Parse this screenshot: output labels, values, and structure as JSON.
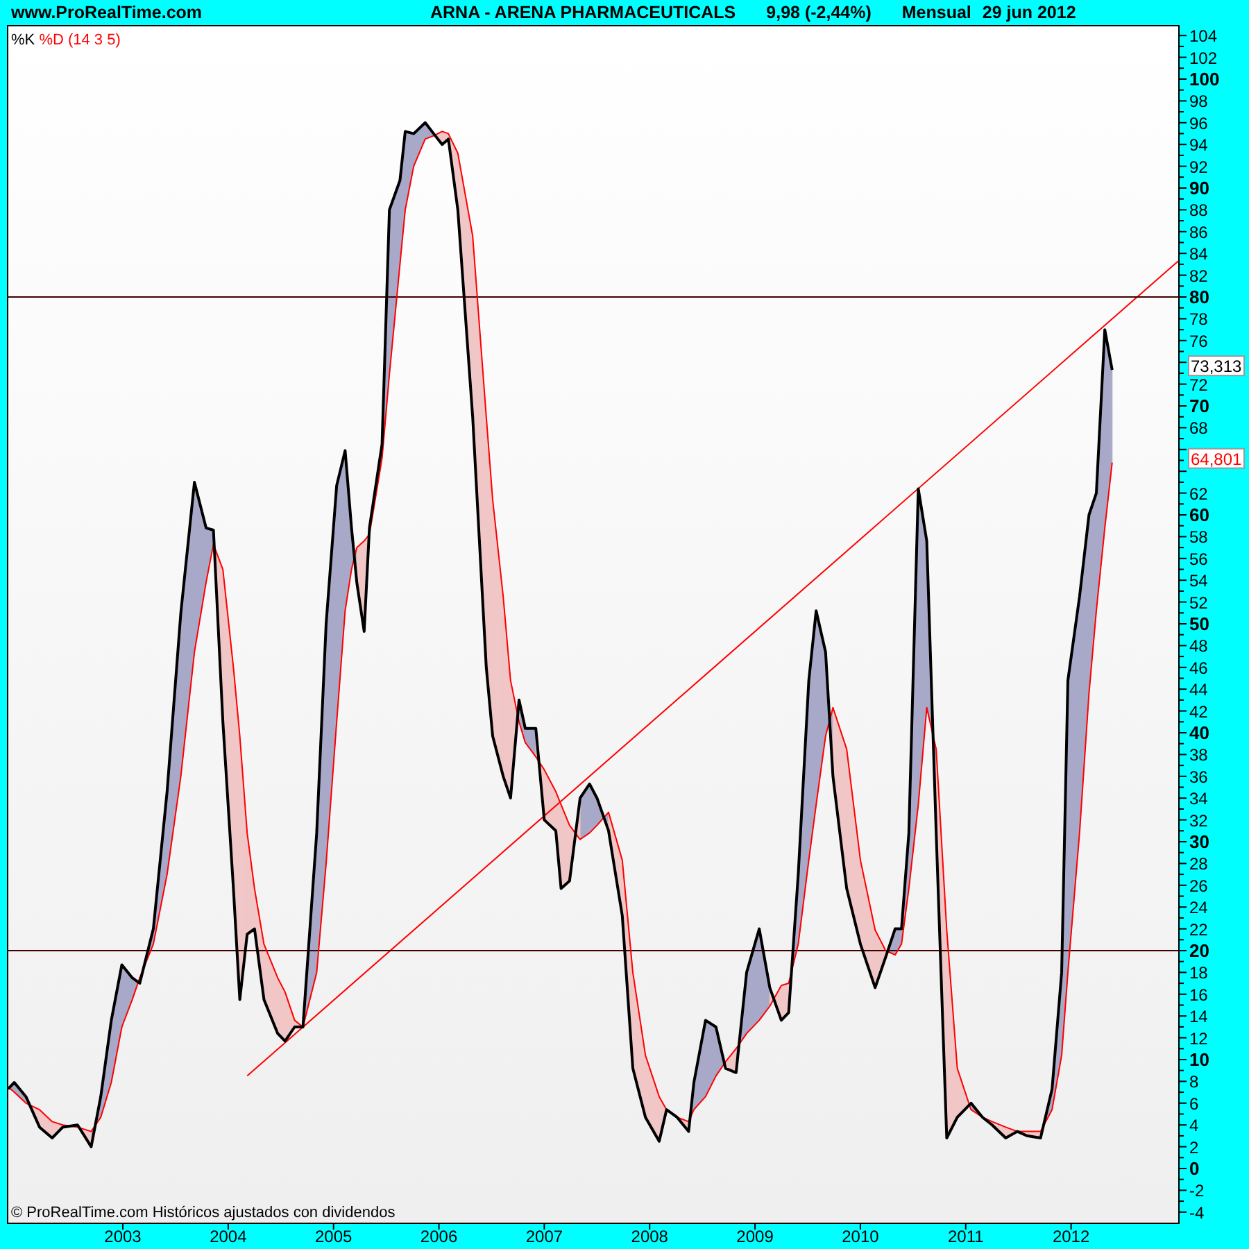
{
  "header": {
    "site": "www.ProRealTime.com",
    "title": "ARNA - ARENA PHARMACEUTICALS",
    "price": "9,98 (-2,44%)",
    "period": "Mensual",
    "date": "29 jun 2012"
  },
  "chart": {
    "legend_suffix": "(14 3 5)",
    "footer": "© ProRealTime.com  Históricos ajustados con dividendos",
    "chart_data": {
      "type": "line",
      "x": [
        2001.91,
        2001.97,
        2002.08,
        2002.21,
        2002.33,
        2002.43,
        2002.57,
        2002.7,
        2002.79,
        2002.89,
        2002.99,
        2003.09,
        2003.16,
        2003.29,
        2003.42,
        2003.55,
        2003.68,
        2003.79,
        2003.86,
        2003.95,
        2004.05,
        2004.11,
        2004.18,
        2004.25,
        2004.34,
        2004.47,
        2004.54,
        2004.63,
        2004.71,
        2004.84,
        2004.93,
        2005.03,
        2005.11,
        2005.17,
        2005.22,
        2005.29,
        2005.34,
        2005.46,
        2005.53,
        2005.63,
        2005.68,
        2005.76,
        2005.87,
        2005.95,
        2006.03,
        2006.09,
        2006.18,
        2006.32,
        2006.45,
        2006.51,
        2006.61,
        2006.68,
        2006.76,
        2006.82,
        2006.92,
        2007.0,
        2007.11,
        2007.16,
        2007.24,
        2007.34,
        2007.43,
        2007.5,
        2007.61,
        2007.74,
        2007.84,
        2007.96,
        2008.09,
        2008.16,
        2008.26,
        2008.37,
        2008.42,
        2008.53,
        2008.63,
        2008.72,
        2008.82,
        2008.92,
        2009.04,
        2009.14,
        2009.25,
        2009.32,
        2009.41,
        2009.51,
        2009.58,
        2009.67,
        2009.74,
        2009.87,
        2010.0,
        2010.14,
        2010.24,
        2010.33,
        2010.39,
        2010.46,
        2010.55,
        2010.63,
        2010.72,
        2010.82,
        2010.92,
        2011.05,
        2011.16,
        2011.25,
        2011.38,
        2011.49,
        2011.58,
        2011.71,
        2011.82,
        2011.91,
        2011.97,
        2012.08,
        2012.17,
        2012.24,
        2012.32,
        2012.39
      ],
      "series": [
        {
          "name": "%K",
          "color": "#000000",
          "values": [
            7.3,
            7.9,
            6.6,
            3.8,
            2.8,
            3.8,
            4,
            2,
            6.6,
            13.6,
            18.7,
            17.5,
            17,
            22,
            34.6,
            51,
            63,
            58.8,
            58.6,
            41,
            25.7,
            15.5,
            21.5,
            22,
            15.5,
            12.4,
            11.7,
            13,
            13,
            30.8,
            50,
            62.7,
            65.9,
            58.8,
            53.8,
            49.3,
            58.8,
            66.5,
            88,
            90.7,
            95.2,
            95,
            96,
            95,
            94,
            94.5,
            88,
            69,
            46,
            39.7,
            36,
            34,
            43,
            40.4,
            40.4,
            32,
            31,
            25.7,
            26.4,
            34,
            35.3,
            34,
            31,
            23.2,
            9.2,
            4.7,
            2.5,
            5.4,
            4.7,
            3.4,
            7.9,
            13.6,
            13,
            9.2,
            8.8,
            18,
            22,
            16.6,
            13.6,
            14.3,
            27,
            44.8,
            51.2,
            47.4,
            36,
            25.7,
            20.6,
            16.6,
            19.4,
            22,
            22,
            30.8,
            62.4,
            57.6,
            30.8,
            2.8,
            4.7,
            6,
            4.7,
            4,
            2.8,
            3.4,
            3,
            2.8,
            7.3,
            18,
            44.8,
            52.5,
            60,
            62,
            77,
            73.3
          ]
        },
        {
          "name": "%D",
          "color": "#ff0000",
          "values": [
            7.5,
            7,
            6,
            5.4,
            4.3,
            4,
            3.8,
            3.4,
            4.7,
            7.9,
            13,
            15.5,
            17.5,
            20.6,
            27,
            36,
            47.4,
            53.8,
            57.3,
            55,
            46,
            39.7,
            30.8,
            25.7,
            20.6,
            17.5,
            16.2,
            13.6,
            13,
            18,
            28,
            41,
            51.2,
            55,
            57,
            57.6,
            58.2,
            65.2,
            72.9,
            83,
            88,
            92,
            94.5,
            94.8,
            95.2,
            95,
            93.2,
            85.6,
            69,
            61.4,
            52.5,
            44.8,
            41,
            39.1,
            37.8,
            36.6,
            34.6,
            33.4,
            31.5,
            30.2,
            30.8,
            31.5,
            32.7,
            28.3,
            18,
            10.4,
            6.6,
            5.4,
            4.7,
            4.3,
            5.4,
            6.6,
            8.5,
            9.8,
            11,
            12.4,
            13.6,
            14.9,
            16.8,
            17,
            20.6,
            28.3,
            33.4,
            39.7,
            42.3,
            38.5,
            28.3,
            21.9,
            20,
            19.6,
            20.6,
            25.7,
            33.4,
            42.3,
            38.5,
            21.9,
            9.2,
            5.4,
            4.7,
            4.3,
            3.8,
            3.4,
            3.4,
            3.4,
            5.4,
            10.4,
            18,
            30.8,
            43.6,
            51.2,
            58.8,
            64.8
          ]
        }
      ],
      "xlim": [
        2001.9,
        2013.03
      ],
      "ylim": [
        -4,
        104
      ],
      "xticks": [
        2003,
        2004,
        2005,
        2006,
        2007,
        2008,
        2009,
        2010,
        2011,
        2012
      ],
      "yticks": [
        -4,
        -2,
        0,
        2,
        4,
        6,
        8,
        10,
        12,
        14,
        16,
        18,
        20,
        22,
        24,
        26,
        28,
        30,
        32,
        34,
        36,
        38,
        40,
        42,
        44,
        46,
        48,
        50,
        52,
        54,
        56,
        58,
        60,
        62,
        68,
        70,
        72,
        76,
        78,
        80,
        82,
        84,
        86,
        88,
        90,
        92,
        94,
        96,
        98,
        100,
        102,
        104
      ],
      "ref_lines": [
        {
          "axis": "y",
          "value": 80
        },
        {
          "axis": "y",
          "value": 20
        }
      ]
    },
    "value_tags": [
      "73,313",
      "64,801"
    ]
  }
}
